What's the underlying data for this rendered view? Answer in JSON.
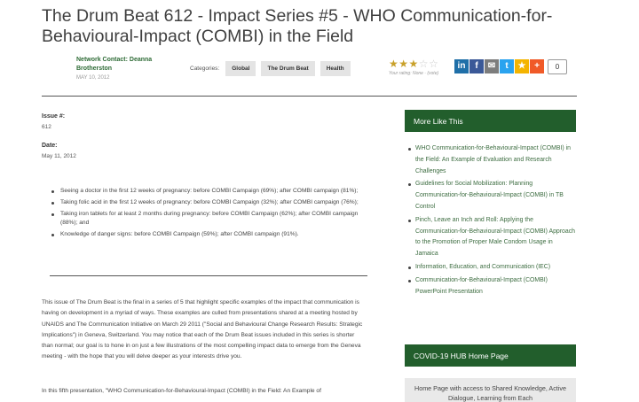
{
  "page": {
    "title": "The Drum Beat 612 - Impact Series #5 - WHO Communication-for-Behavioural-Impact (COMBI) in the Field"
  },
  "contact": {
    "name": "Network Contact: Deanna Brotherston",
    "date": "MAY 10, 2012"
  },
  "categories": {
    "label": "Categories:",
    "tags": [
      "Global",
      "The Drum Beat",
      "Health"
    ]
  },
  "rating": {
    "filled": 3,
    "total": 5,
    "note": "Your rating: None · (vote)"
  },
  "share": {
    "icons": [
      "linkedin-icon",
      "facebook-icon",
      "email-icon",
      "twitter-icon",
      "favorite-icon",
      "plus-icon"
    ],
    "glyphs": [
      "in",
      "f",
      "✉",
      "t",
      "★",
      "+"
    ],
    "colors": [
      "#1f6fa8",
      "#3b5998",
      "#7d7d7d",
      "#2aa3ef",
      "#f4b400",
      "#f05a28"
    ],
    "count": "0"
  },
  "issue": {
    "label": "Issue #:",
    "value": "612"
  },
  "date": {
    "label": "Date:",
    "value": "May 11, 2012"
  },
  "bullets": [
    "Seeing a doctor in the first 12 weeks of pregnancy: before COMBI Campaign (69%); after COMBI campaign (81%);",
    "Taking folic acid in the first 12 weeks of pregnancy: before COMBI Campaign (32%); after COMBI campaign (76%);",
    "Taking iron tablets for at least 2 months during pregnancy: before COMBI Campaign (62%); after COMBI campaign (88%); and",
    "Knowledge of danger signs: before COMBI Campaign (59%); after COMBI campaign (91%)."
  ],
  "body": {
    "p1": "This issue of The Drum Beat is the final in a series of 5 that highlight specific examples of the impact that communication is having on development in a myriad of ways. These examples are culled from presentations shared at a meeting hosted by UNAIDS and The Communication Initiative on March 29 2011 (\"Social and Behavioural Change Research Results: Strategic Implications\") in Geneva, Switzerland. You may notice that each of the Drum Beat issues included in this series is shorter than normal; our goal is to hone in on just a few illustrations of the most compelling impact data to emerge from the Geneva meeting - with the hope that you will delve deeper as your interests drive you.",
    "p2": "In this fifth presentation, \"WHO Communication-for-Behavioural-Impact (COMBI) in the Field: An Example of"
  },
  "more_like_this": {
    "heading": "More Like This",
    "items": [
      "WHO Communication-for-Behavioural-Impact (COMBI) in the Field: An Example of Evaluation and Research Challenges",
      "Guidelines for Social Mobilization: Planning Communication-for-Behavioural-Impact (COMBI) in TB Control",
      "Pinch, Leave an Inch and Roll: Applying the Communication-for-Behavioural-Impact (COMBI) Approach to the Promotion of Proper Male Condom Usage in Jamaica",
      "Information, Education, and Communication (IEC)",
      "Communication-for-Behavioural-Impact (COMBI) PowerPoint Presentation"
    ]
  },
  "covid": {
    "heading": "COVID-19 HUB Home Page",
    "text": "Home Page with access to Shared Knowledge, Active Dialogue, Learning from Each"
  }
}
